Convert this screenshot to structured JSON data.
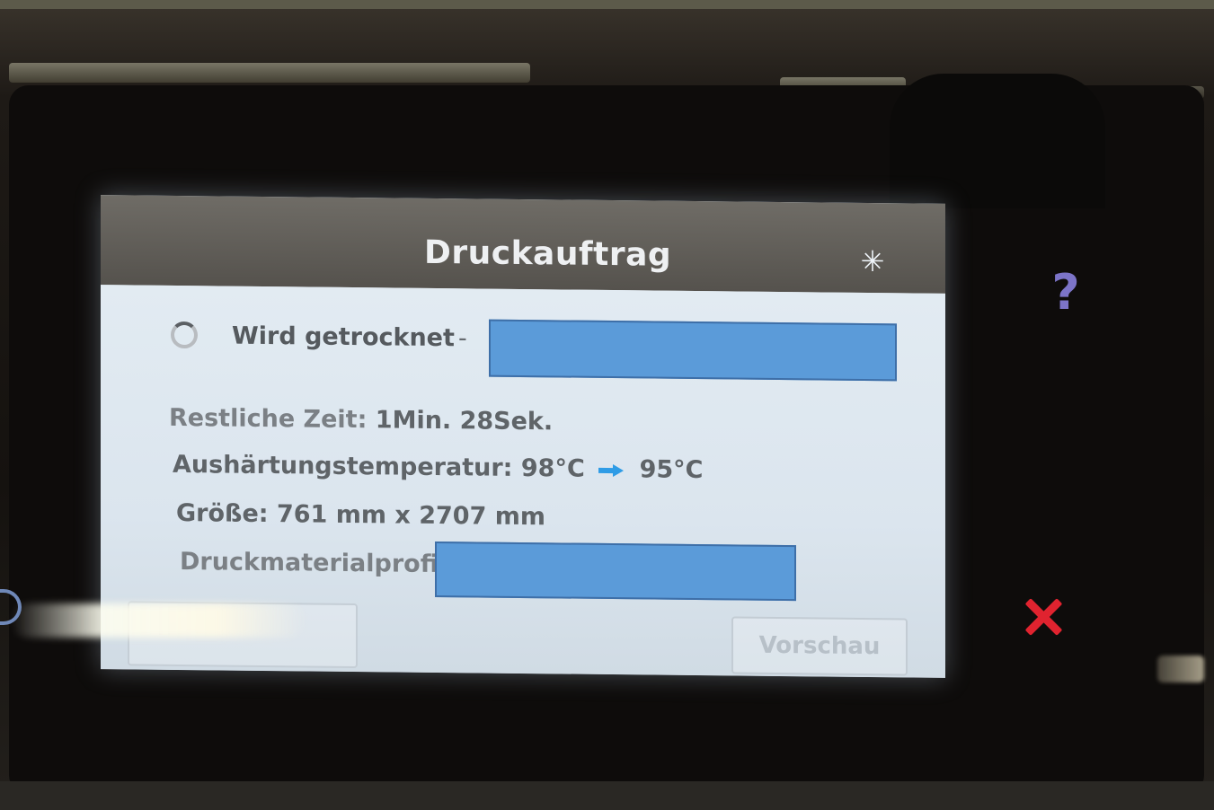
{
  "screen": {
    "title": "Druckauftrag",
    "header_icon": "sun-icon",
    "status": {
      "icon": "spinner-icon",
      "text": "Wird getrocknet",
      "separator": "-",
      "job_name": ""
    },
    "info": {
      "time_label": "Restliche Zeit:",
      "time_value": "1Min. 28Sek.",
      "temp_label": "Aushärtungstemperatur:",
      "temp_current": "98°C",
      "temp_target": "95°C",
      "size_label": "Größe:",
      "size_value": "761 mm x 2707 mm",
      "media_label": "Druckmaterialprofil:",
      "media_value": ""
    },
    "buttons": {
      "preview_label": "Vorschau"
    }
  },
  "side_controls": {
    "help_label": "?",
    "help_color": "#7c74c8",
    "cancel_icon": "close-icon",
    "cancel_color": "#e0232f"
  },
  "colors": {
    "header_bg": "#5f5c57",
    "content_bg": "#dde6ee",
    "redaction": "#5b9bd9",
    "arrow": "#2f9ce6"
  }
}
